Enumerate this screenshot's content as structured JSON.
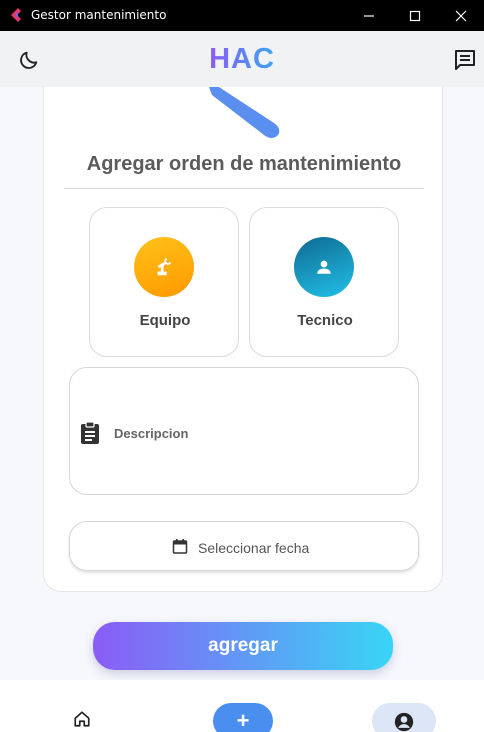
{
  "window": {
    "title": "Gestor mantenimiento",
    "minimize_icon": "minimize-icon",
    "maximize_icon": "maximize-icon",
    "close_icon": "close-icon"
  },
  "appbar": {
    "brand": "HAC",
    "theme_icon": "moon-icon",
    "chat_icon": "chat-icon"
  },
  "form": {
    "title": "Agregar orden de mantenimiento",
    "equipo_label": "Equipo",
    "tecnico_label": "Tecnico",
    "description_placeholder": "Descripcion",
    "date_label": "Seleccionar fecha",
    "submit_label": "agregar"
  },
  "nav": {
    "add_symbol": "+",
    "items": [
      "home-icon",
      "add-icon",
      "account-icon"
    ]
  },
  "colors": {
    "accent_purple": "#8b5cf6",
    "accent_cyan": "#38d5f5",
    "equipo_orange": "#ffa000",
    "tecnico_blue": "#1590b8",
    "nav_add": "#4a8ef0"
  }
}
